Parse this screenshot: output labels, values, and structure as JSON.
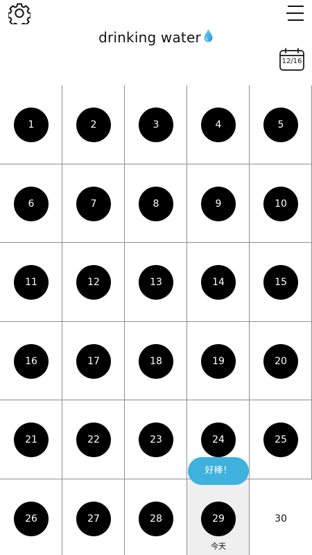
{
  "header": {
    "settings_icon": "gear-icon",
    "menu_icon": "menu-lines-icon",
    "title": "drinking water",
    "title_icon": "water-drop-icon",
    "calendar_icon": "calendar-icon",
    "calendar_date": "12/16"
  },
  "calendar": {
    "days": [
      {
        "label": "1",
        "state": "filled"
      },
      {
        "label": "2",
        "state": "filled"
      },
      {
        "label": "3",
        "state": "filled"
      },
      {
        "label": "4",
        "state": "filled"
      },
      {
        "label": "5",
        "state": "filled"
      },
      {
        "label": "6",
        "state": "filled"
      },
      {
        "label": "7",
        "state": "filled"
      },
      {
        "label": "8",
        "state": "filled"
      },
      {
        "label": "9",
        "state": "filled"
      },
      {
        "label": "10",
        "state": "filled"
      },
      {
        "label": "11",
        "state": "filled"
      },
      {
        "label": "12",
        "state": "filled"
      },
      {
        "label": "13",
        "state": "filled"
      },
      {
        "label": "14",
        "state": "filled"
      },
      {
        "label": "15",
        "state": "filled"
      },
      {
        "label": "16",
        "state": "filled"
      },
      {
        "label": "17",
        "state": "filled"
      },
      {
        "label": "18",
        "state": "filled"
      },
      {
        "label": "19",
        "state": "filled"
      },
      {
        "label": "20",
        "state": "filled"
      },
      {
        "label": "21",
        "state": "filled"
      },
      {
        "label": "22",
        "state": "filled"
      },
      {
        "label": "23",
        "state": "filled"
      },
      {
        "label": "24",
        "state": "filled"
      },
      {
        "label": "25",
        "state": "filled"
      },
      {
        "label": "26",
        "state": "filled"
      },
      {
        "label": "27",
        "state": "filled"
      },
      {
        "label": "28",
        "state": "filled"
      },
      {
        "label": "29",
        "state": "today"
      },
      {
        "label": "30",
        "state": "future"
      }
    ],
    "today_label": "今天",
    "praise": "好棒！"
  },
  "colors": {
    "accent": "#3fb1dd",
    "filled_circle": "#000000",
    "today_background": "#efefef",
    "grid_line": "#8d8d8d"
  }
}
